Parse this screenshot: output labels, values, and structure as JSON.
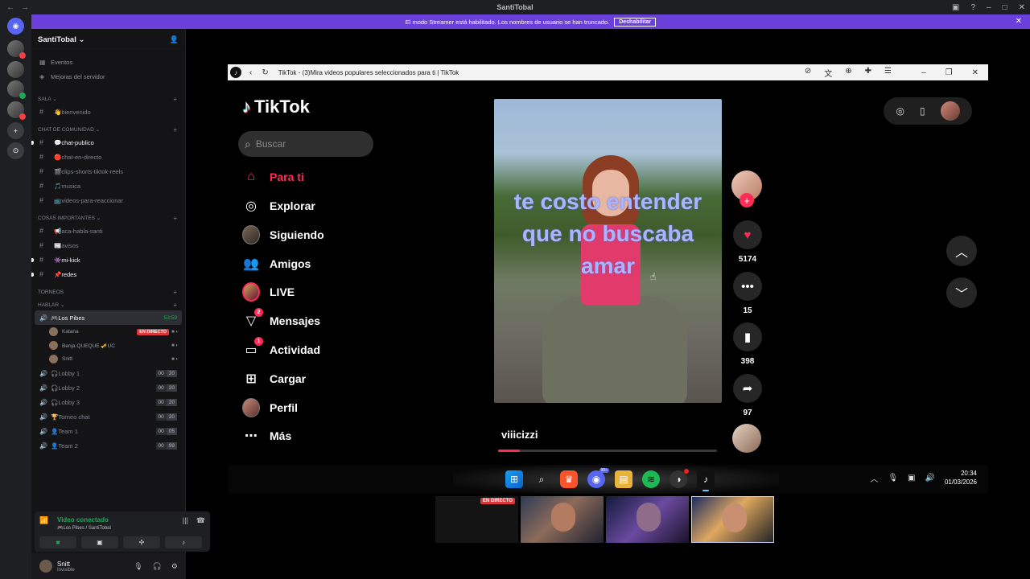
{
  "discord": {
    "window_title": "SantiTobal",
    "banner": {
      "text": "El modo Streamer está habilitado. Los nombres de usuario se han truncado.",
      "button": "Deshabilitar"
    },
    "server_name": "SantiTobal",
    "top_links": [
      "Eventos",
      "Mejoras del servidor"
    ],
    "categories": {
      "sala": "Sala",
      "comunidad": "CHAT DE COMUNIDAD",
      "importantes": "COSAS IMPORTANTES",
      "torneos": "TORNEOS",
      "hablar": "HABLAR"
    },
    "sala_channels": [
      "👋bienvenido"
    ],
    "community_channels": [
      {
        "name": "💬chat-publico",
        "unread": true
      },
      {
        "name": "🔴chat-en-directo",
        "unread": false
      },
      {
        "name": "🎬clips-shorts-tiktok-reels",
        "unread": false
      },
      {
        "name": "🎵musica",
        "unread": false
      },
      {
        "name": "📺videos-para-reaccionar",
        "unread": false
      }
    ],
    "important_channels": [
      {
        "name": "📢aca-habla-santi",
        "unread": false
      },
      {
        "name": "📰avisos",
        "unread": false
      },
      {
        "name": "👾mi-kick",
        "unread": true
      },
      {
        "name": "📌redes",
        "unread": true
      }
    ],
    "active_voice": {
      "name": "🎮Los Pibes",
      "timer": "53:59"
    },
    "members": [
      {
        "name": "Katana",
        "live": "EN DIRECTO"
      },
      {
        "name": "Benja QUEQUE 🎺UC",
        "live": ""
      },
      {
        "name": "Snitt",
        "live": ""
      }
    ],
    "voice_channels": [
      {
        "name": "🎧Lobby 1",
        "a": "00",
        "b": "20"
      },
      {
        "name": "🎧Lobby 2",
        "a": "00",
        "b": "20"
      },
      {
        "name": "🎧Lobby 3",
        "a": "00",
        "b": "20"
      },
      {
        "name": "🏆Torneo chat",
        "a": "00",
        "b": "20"
      },
      {
        "name": "👤Team 1",
        "a": "00",
        "b": "05"
      },
      {
        "name": "👤Team 2",
        "a": "00",
        "b": "99"
      }
    ],
    "voice_panel": {
      "status": "Video conectado",
      "location": "🎮Los Pibes / SantiTobal"
    },
    "user": {
      "name": "Snitt",
      "status": "Invisible"
    }
  },
  "browser": {
    "tab_title": "TikTok - (3)Mira videos populares seleccionados para ti | TikTok"
  },
  "tiktok": {
    "logo": "TikTok",
    "search_placeholder": "Buscar",
    "nav": [
      {
        "label": "Para ti",
        "icon": "home-icon",
        "active": true
      },
      {
        "label": "Explorar",
        "icon": "compass-icon"
      },
      {
        "label": "Siguiendo",
        "icon": "avatar"
      },
      {
        "label": "Amigos",
        "icon": "friends-icon"
      },
      {
        "label": "LIVE",
        "icon": "live-avatar"
      },
      {
        "label": "Mensajes",
        "icon": "send-icon",
        "badge": "2"
      },
      {
        "label": "Actividad",
        "icon": "inbox-icon",
        "badge": "1"
      },
      {
        "label": "Cargar",
        "icon": "upload-icon"
      },
      {
        "label": "Perfil",
        "icon": "profile-avatar"
      },
      {
        "label": "Más",
        "icon": "more-icon"
      }
    ],
    "video": {
      "caption": "te costo entender que no buscaba amar",
      "author": "viiicizzi",
      "progress": 0.1,
      "likes": "5174",
      "comments": "15",
      "saves": "398",
      "shares": "97"
    },
    "colors": {
      "accent": "#fe2c55"
    }
  },
  "taskbar": {
    "discord_badge": "99+",
    "time": "20:34",
    "date": "01/03/2026"
  },
  "previews": {
    "live_tag": "EN DIRECTO"
  }
}
